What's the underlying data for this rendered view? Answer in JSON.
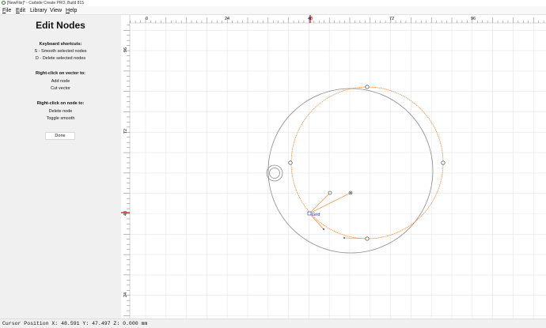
{
  "window": {
    "title": "[NewFile]* - Carbide Create PRO, Build 815"
  },
  "menu": {
    "items": [
      {
        "label": "File",
        "accel": "F",
        "rest": "ile"
      },
      {
        "label": "Edit",
        "accel": "E",
        "rest": "dit"
      },
      {
        "label": "Library",
        "accel": "",
        "rest": "Library"
      },
      {
        "label": "View",
        "accel": "",
        "rest": "View"
      },
      {
        "label": "Help",
        "accel": "H",
        "rest": "elp"
      }
    ]
  },
  "sidebar": {
    "title": "Edit Nodes",
    "shortcuts_heading": "Keyboard shortcuts:",
    "shortcut_s": "S - Smooth selected nodes",
    "shortcut_d": "D - Delete selected nodes",
    "vector_heading": "Right-click on vector to:",
    "vector_add": "Add node",
    "vector_cut": "Cut vector",
    "node_heading": "Right-click on node to:",
    "node_delete": "Delete node",
    "node_toggle": "Toggle smooth",
    "done_label": "Done"
  },
  "canvas": {
    "x_ticks": [
      "0",
      "24",
      "48",
      "72",
      "96"
    ],
    "y_ticks": [
      "96",
      "72",
      "48",
      "24"
    ],
    "grid_label": "Grid",
    "colors": {
      "grid": "#e4e4e4",
      "circle": "#8a8a8a",
      "selection": "#f07820",
      "ruler_marker": "#d00000",
      "grid_label": "#2030c0"
    }
  },
  "status": {
    "text": "Cursor Position X: 48.591 Y: 47.497 Z: 0.000 mm"
  }
}
